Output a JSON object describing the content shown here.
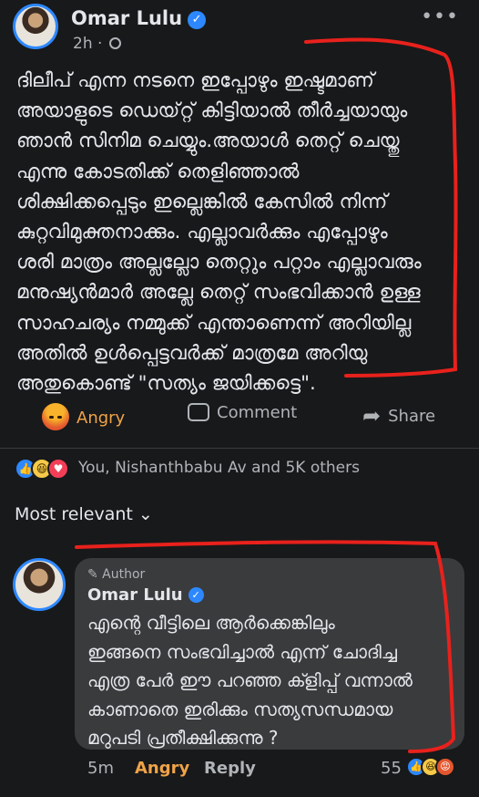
{
  "post": {
    "author": "Omar Lulu",
    "verified_mark": "✓",
    "time": "2h",
    "separator": "·",
    "more": "•••",
    "lines": [
      "ദിലീപ് എന്ന നടനെ ഇപ്പോഴും ഇഷ്ടമാണ്",
      "അയാളുടെ ഡെയ്റ്റ് കിട്ടിയാൽ തീർച്ചയായും",
      "ഞാൻ സിനിമ ചെയ്യും.അയാൾ തെറ്റ് ചെയ്തു",
      "എന്നു കോടതിക്ക് തെളിഞ്ഞാൽ",
      "ശിക്ഷിക്കപ്പെടും ഇല്ലെങ്കിൽ കേസിൽ നിന്ന്",
      "കുറ്റവിമുക്തനാക്കും. എല്ലാവർക്കും എപ്പോഴും",
      "ശരി മാത്രം അല്ലല്ലോ തെറ്റും പറ്റാം എല്ലാവരും",
      "മനുഷ്യൻമാർ അല്ലേ തെറ്റ് സംഭവിക്കാൻ ഉള്ള",
      "സാഹചര്യം നമ്മുക്ക് എന്താണെന്ന് അറിയില്ല",
      "അതിൽ ഉൾപ്പെട്ടവർക്ക് മാത്രമേ അറിയു",
      "അതുകൊണ്ട് \"സത്യം ജയിക്കട്ടെ\"."
    ]
  },
  "actions": {
    "react_label": "Angry",
    "comment_label": "Comment",
    "share_label": "Share",
    "share_glyph": "➦"
  },
  "reactions": {
    "like_glyph": "👍",
    "haha_glyph": "😆",
    "love_glyph": "♥",
    "angry_glyph": "😡",
    "summary": "You, Nishanthbabu Av and 5K others"
  },
  "sort": {
    "label": "Most relevant",
    "chevron": "⌄"
  },
  "comment": {
    "badge": "✎ Author",
    "author": "Omar Lulu",
    "lines": [
      "എന്റെ വീട്ടിലെ ആർക്കെങ്കിലും",
      "ഇങ്ങനെ സംഭവിച്ചാൽ എന്ന് ചോദിച്ച",
      "എത്ര പേർ ഈ പറഞ്ഞ ക്ളിപ്പ് വന്നാൽ",
      "കാണാതെ ഇരിക്കും സത്യസന്ധമായ",
      "മറുപടി പ്രതീക്ഷിക്കുന്നു ?"
    ],
    "time": "5m",
    "react_label": "Angry",
    "reply_label": "Reply",
    "reaction_count": "55"
  },
  "colors": {
    "background": "#18191a",
    "comment_bubble": "#3a3b3c",
    "angry_accent": "#f0a348",
    "verified_blue": "#2d88ff",
    "annotation_red": "#e8211c"
  }
}
